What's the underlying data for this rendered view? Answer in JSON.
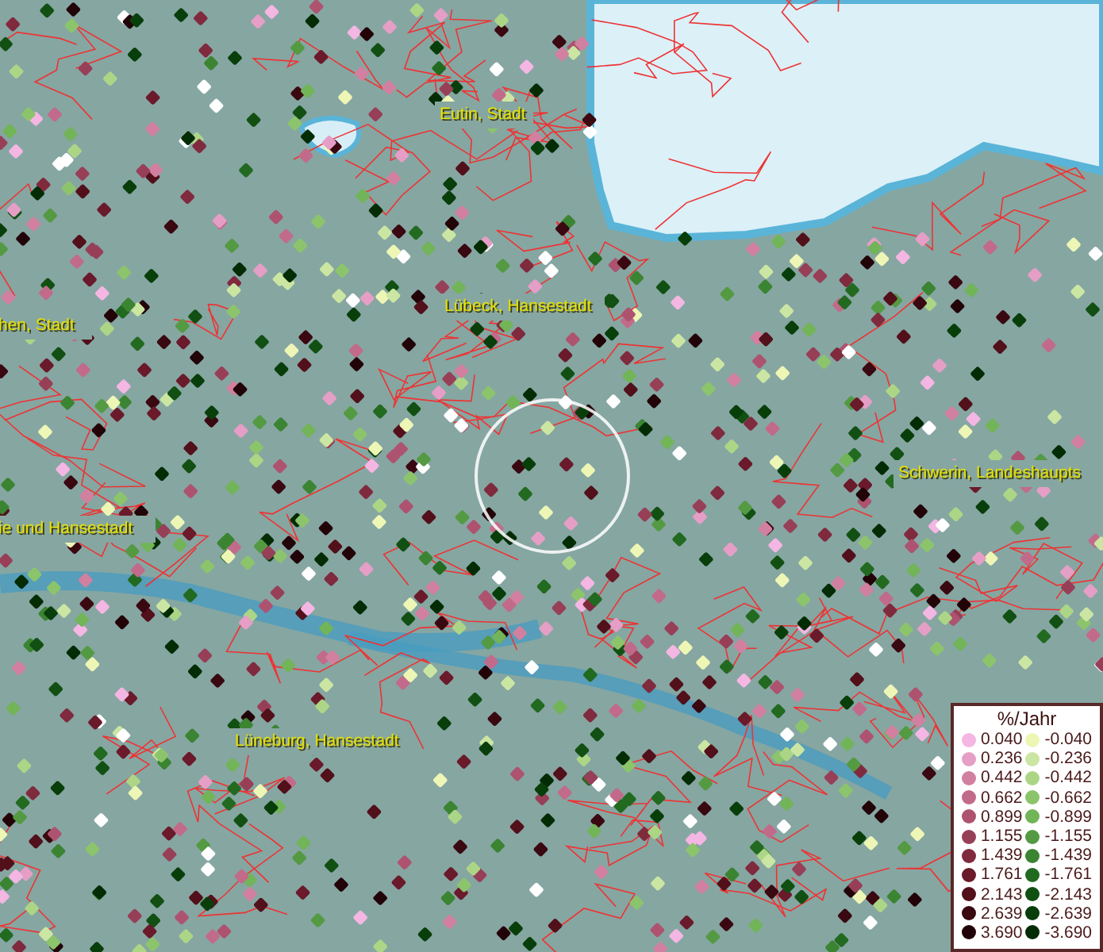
{
  "map": {
    "labels": [
      {
        "text": "Eutin, Stadt"
      },
      {
        "text": "Lübeck, Hansestadt"
      },
      {
        "text": "hen, Stadt"
      },
      {
        "text": "ie und Hansestadt"
      },
      {
        "text": "Schwerin, Landeshaupts"
      },
      {
        "text": "Lüneburg, Hansestadt"
      }
    ]
  },
  "legend": {
    "title": "%/Jahr",
    "columns": [
      {
        "items": [
          {
            "label": "0.040",
            "color": "#f4b6e2"
          },
          {
            "label": "0.236",
            "color": "#e59ec6"
          },
          {
            "label": "0.442",
            "color": "#d2809f"
          },
          {
            "label": "0.662",
            "color": "#c26a8a"
          },
          {
            "label": "0.899",
            "color": "#ad5370"
          },
          {
            "label": "1.155",
            "color": "#983f58"
          },
          {
            "label": "1.439",
            "color": "#802a3e"
          },
          {
            "label": "1.761",
            "color": "#6a1a2a"
          },
          {
            "label": "2.143",
            "color": "#52101a"
          },
          {
            "label": "2.639",
            "color": "#3a0810"
          },
          {
            "label": "3.690",
            "color": "#220408"
          }
        ]
      },
      {
        "items": [
          {
            "label": "-0.040",
            "color": "#eef6b6"
          },
          {
            "label": "-0.236",
            "color": "#cbe6a2"
          },
          {
            "label": "-0.442",
            "color": "#acd686"
          },
          {
            "label": "-0.662",
            "color": "#8cc46c"
          },
          {
            "label": "-0.899",
            "color": "#72b458"
          },
          {
            "label": "-1.155",
            "color": "#549a42"
          },
          {
            "label": "-1.439",
            "color": "#3b8432"
          },
          {
            "label": "-1.761",
            "color": "#226a20"
          },
          {
            "label": "-2.143",
            "color": "#115012"
          },
          {
            "label": "-2.639",
            "color": "#083e0a"
          },
          {
            "label": "-3.690",
            "color": "#032c05"
          }
        ]
      }
    ]
  }
}
